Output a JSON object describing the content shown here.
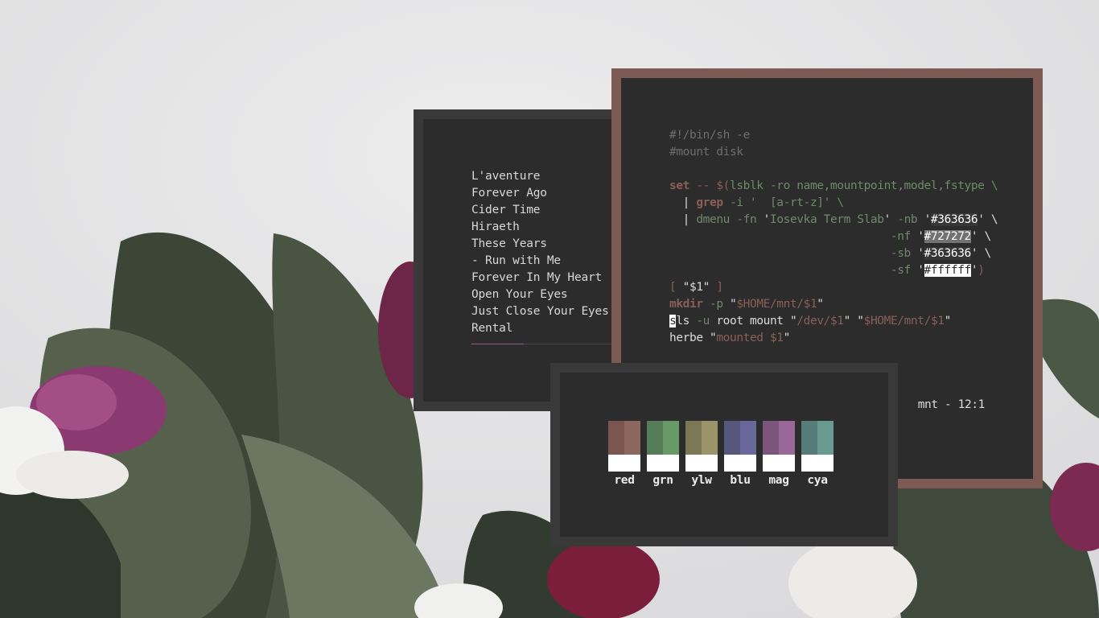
{
  "music_player": {
    "tracks": [
      {
        "title": "L'aventure"
      },
      {
        "title": "Forever Ago"
      },
      {
        "title": "Cider Time"
      },
      {
        "title": "Hiraeth"
      },
      {
        "title": "These Years"
      },
      {
        "title": "- Run with Me"
      },
      {
        "title": "Forever In My Heart"
      },
      {
        "title": "Open Your Eyes"
      },
      {
        "title": "Just Close Your Eyes"
      },
      {
        "title": "Rental"
      }
    ],
    "progress": 0.37,
    "progress_color": "#8f5f86"
  },
  "terminal": {
    "lines": {
      "l1": "#!/bin/sh -e",
      "l2": "#mount disk",
      "l4a": "set",
      "l4b": " -- $(",
      "l4c": "lsblk -ro name,mountpoint,model,fstype \\",
      "l5a": "  | ",
      "l5b": "grep",
      "l5c": " -i '  ",
      "l5d": "[a-rt-z]",
      "l5e": "' \\",
      "l6a": "  | ",
      "l6b": "dmenu -fn ",
      "l6c": "'",
      "l6d": "Iosevka Term Slab",
      "l6e": "'",
      "l6f": " -nb ",
      "l6g": "'",
      "l6h": "#363636",
      "l6i": "' \\",
      "l7a": "                                 -nf ",
      "l7b": "'",
      "l7c": "#727272",
      "l7d": "' \\",
      "l8a": "                                 -sb ",
      "l8b": "'",
      "l8c": "#363636",
      "l8d": "' \\",
      "l9a": "                                 -sf ",
      "l9b": "'",
      "l9c": "#ffffff",
      "l9d": "'",
      "l9e": ")",
      "l10a": "[ ",
      "l10b": "\"$1\"",
      "l10c": " ]",
      "l11a": "mkdir",
      "l11b": " -p ",
      "l11c": "\"",
      "l11d": "$HOME/mnt/$1",
      "l11e": "\"",
      "l12a": "s",
      "l12b": "ls",
      "l12c": " -u ",
      "l12d": "root mount ",
      "l12e": "\"",
      "l12f": "/dev/$1",
      "l12g": "\" \"",
      "l12h": "$HOME/mnt/$1",
      "l12i": "\"",
      "l13a": "herbe ",
      "l13b": "\"",
      "l13c": "mounted $1",
      "l13d": "\""
    },
    "status": "mnt - 12:1",
    "border_color": "#7e5a55"
  },
  "palette": {
    "swatches": [
      {
        "label": "red",
        "dark": "#7c5550",
        "light": "#8d6660"
      },
      {
        "label": "grn",
        "dark": "#557c57",
        "light": "#689a68"
      },
      {
        "label": "ylw",
        "dark": "#7c7855",
        "light": "#9a9468"
      },
      {
        "label": "blu",
        "dark": "#55577c",
        "light": "#68689a"
      },
      {
        "label": "mag",
        "dark": "#7c557c",
        "light": "#9a6898"
      },
      {
        "label": "cya",
        "dark": "#557c78",
        "light": "#689a90"
      }
    ]
  }
}
